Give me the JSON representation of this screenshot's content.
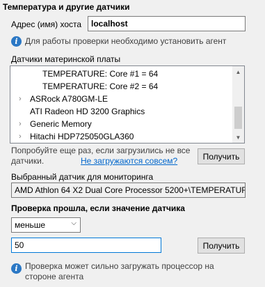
{
  "section": {
    "title": "Температура и другие датчики"
  },
  "host": {
    "label": "Адрес (имя) хоста",
    "value": "localhost"
  },
  "agent_hint": "Для работы проверки необходимо установить агент",
  "sensors": {
    "label": "Датчики материнской платы",
    "items": [
      {
        "text": "TEMPERATURE:  Core #1 = 64",
        "expandable": false
      },
      {
        "text": "TEMPERATURE:  Core #2 = 64",
        "expandable": false
      },
      {
        "text": "ASRock A780GM-LE",
        "expandable": true
      },
      {
        "text": "ATI Radeon HD 3200 Graphics",
        "expandable": false
      },
      {
        "text": "Generic Memory",
        "expandable": true
      },
      {
        "text": "Hitachi HDP725050GLA360",
        "expandable": true
      }
    ]
  },
  "retry": {
    "line1": "Попробуйте еще раз, если загрузились не все",
    "line2": "датчики.",
    "link": "Не загружаются совсем?"
  },
  "get_button_label": "Получить",
  "selected": {
    "label": "Выбранный датчик для мониторинга",
    "value": "AMD Athlon 64 X2 Dual Core Processor 5200+\\TEMPERATURE:"
  },
  "check": {
    "title": "Проверка прошла, если значение датчика",
    "operator": "меньше",
    "value": "50"
  },
  "cpu_hint": {
    "line1": "Проверка может сильно загружать процессор на",
    "line2": "стороне агента"
  }
}
